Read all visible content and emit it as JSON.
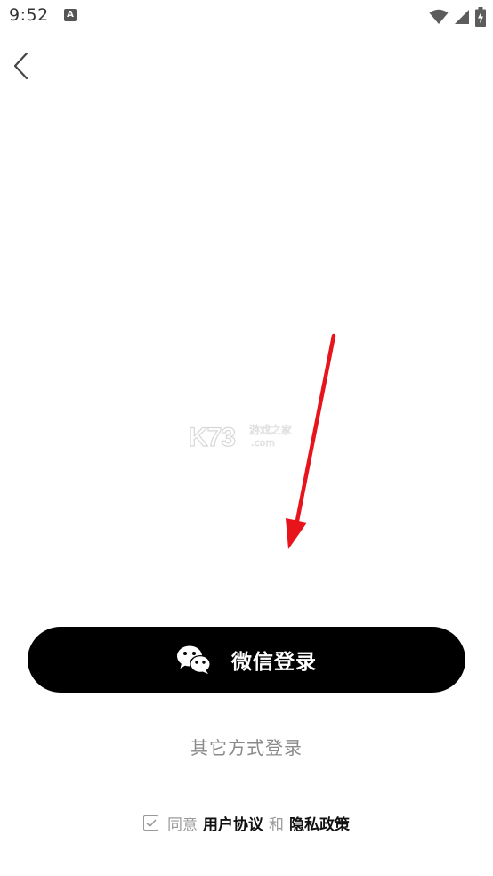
{
  "status_bar": {
    "time": "9:52",
    "app_icon_letter": "A",
    "icons": [
      "wifi-icon",
      "cell-signal-icon",
      "battery-charging-icon"
    ]
  },
  "nav": {
    "back_icon": "chevron-left-icon"
  },
  "watermark": {
    "logo_text": "K73",
    "tagline": "游戏之家",
    "domain": ".com"
  },
  "annotation": {
    "arrow_color": "#e8141c"
  },
  "login": {
    "wechat_button_label": "微信登录",
    "wechat_icon": "wechat-icon",
    "other_methods_label": "其它方式登录"
  },
  "agreement": {
    "prefix": "同意",
    "user_agreement": "用户协议",
    "connector": "和",
    "privacy_policy": "隐私政策",
    "checked": true
  }
}
